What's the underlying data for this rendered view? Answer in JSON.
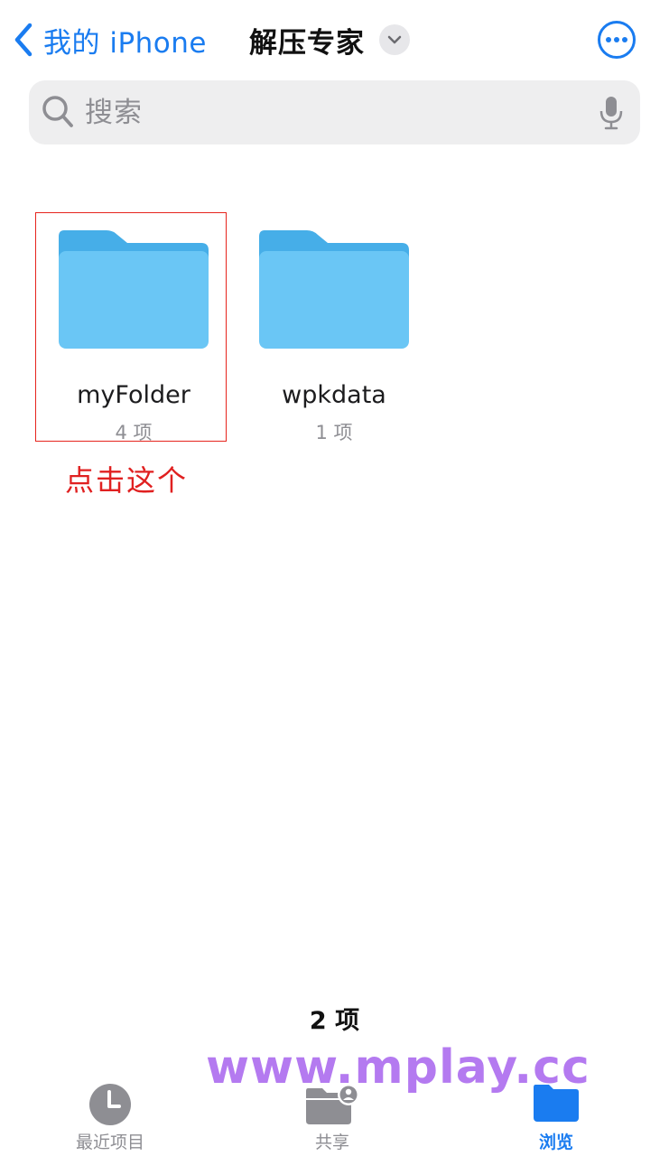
{
  "nav": {
    "back_label": "我的 iPhone",
    "title": "解压专家"
  },
  "search": {
    "placeholder": "搜索"
  },
  "files": [
    {
      "name": "myFolder",
      "count": "4 项"
    },
    {
      "name": "wpkdata",
      "count": "1 项"
    }
  ],
  "annotation": {
    "text": "点击这个",
    "color": "#e02020"
  },
  "footer": {
    "item_count": "2 项"
  },
  "watermark": "www.mplay.cc",
  "tabs": [
    {
      "label": "最近项目",
      "icon": "clock-icon",
      "active": false
    },
    {
      "label": "共享",
      "icon": "shared-folder-icon",
      "active": false
    },
    {
      "label": "浏览",
      "icon": "folder-icon",
      "active": true
    }
  ],
  "colors": {
    "accent": "#1a7cf0",
    "folder": "#5bbef2",
    "annotation_border": "#e6241d",
    "watermark": "#b47af0"
  }
}
